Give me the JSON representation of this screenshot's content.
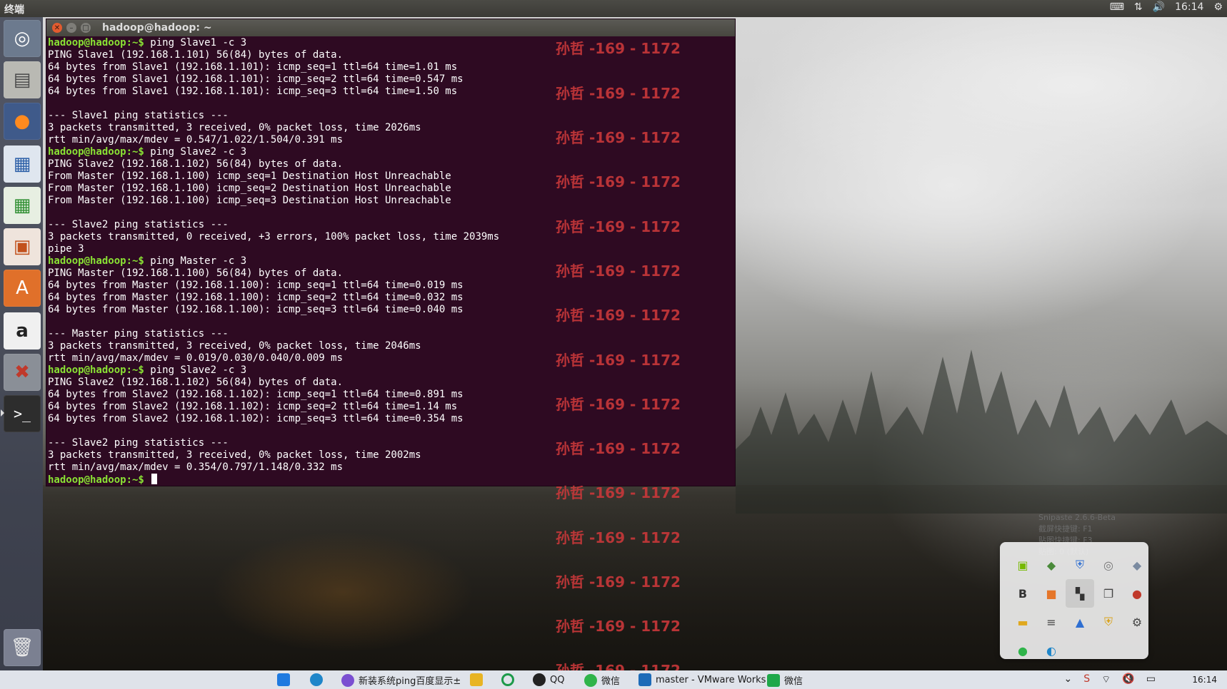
{
  "top_panel": {
    "app_title": "终端",
    "time": "16:14"
  },
  "terminal": {
    "window_title": "hadoop@hadoop: ~",
    "lines": [
      {
        "prompt": "hadoop@hadoop:~$ ",
        "text": "ping Slave1 -c 3"
      },
      {
        "prompt": "",
        "text": "PING Slave1 (192.168.1.101) 56(84) bytes of data."
      },
      {
        "prompt": "",
        "text": "64 bytes from Slave1 (192.168.1.101): icmp_seq=1 ttl=64 time=1.01 ms"
      },
      {
        "prompt": "",
        "text": "64 bytes from Slave1 (192.168.1.101): icmp_seq=2 ttl=64 time=0.547 ms"
      },
      {
        "prompt": "",
        "text": "64 bytes from Slave1 (192.168.1.101): icmp_seq=3 ttl=64 time=1.50 ms"
      },
      {
        "prompt": "",
        "text": ""
      },
      {
        "prompt": "",
        "text": "--- Slave1 ping statistics ---"
      },
      {
        "prompt": "",
        "text": "3 packets transmitted, 3 received, 0% packet loss, time 2026ms"
      },
      {
        "prompt": "",
        "text": "rtt min/avg/max/mdev = 0.547/1.022/1.504/0.391 ms"
      },
      {
        "prompt": "hadoop@hadoop:~$ ",
        "text": "ping Slave2 -c 3"
      },
      {
        "prompt": "",
        "text": "PING Slave2 (192.168.1.102) 56(84) bytes of data."
      },
      {
        "prompt": "",
        "text": "From Master (192.168.1.100) icmp_seq=1 Destination Host Unreachable"
      },
      {
        "prompt": "",
        "text": "From Master (192.168.1.100) icmp_seq=2 Destination Host Unreachable"
      },
      {
        "prompt": "",
        "text": "From Master (192.168.1.100) icmp_seq=3 Destination Host Unreachable"
      },
      {
        "prompt": "",
        "text": ""
      },
      {
        "prompt": "",
        "text": "--- Slave2 ping statistics ---"
      },
      {
        "prompt": "",
        "text": "3 packets transmitted, 0 received, +3 errors, 100% packet loss, time 2039ms"
      },
      {
        "prompt": "",
        "text": "pipe 3"
      },
      {
        "prompt": "hadoop@hadoop:~$ ",
        "text": "ping Master -c 3"
      },
      {
        "prompt": "",
        "text": "PING Master (192.168.1.100) 56(84) bytes of data."
      },
      {
        "prompt": "",
        "text": "64 bytes from Master (192.168.1.100): icmp_seq=1 ttl=64 time=0.019 ms"
      },
      {
        "prompt": "",
        "text": "64 bytes from Master (192.168.1.100): icmp_seq=2 ttl=64 time=0.032 ms"
      },
      {
        "prompt": "",
        "text": "64 bytes from Master (192.168.1.100): icmp_seq=3 ttl=64 time=0.040 ms"
      },
      {
        "prompt": "",
        "text": ""
      },
      {
        "prompt": "",
        "text": "--- Master ping statistics ---"
      },
      {
        "prompt": "",
        "text": "3 packets transmitted, 3 received, 0% packet loss, time 2046ms"
      },
      {
        "prompt": "",
        "text": "rtt min/avg/max/mdev = 0.019/0.030/0.040/0.009 ms"
      },
      {
        "prompt": "hadoop@hadoop:~$ ",
        "text": "ping Slave2 -c 3"
      },
      {
        "prompt": "",
        "text": "PING Slave2 (192.168.1.102) 56(84) bytes of data."
      },
      {
        "prompt": "",
        "text": "64 bytes from Slave2 (192.168.1.102): icmp_seq=1 ttl=64 time=0.891 ms"
      },
      {
        "prompt": "",
        "text": "64 bytes from Slave2 (192.168.1.102): icmp_seq=2 ttl=64 time=1.14 ms"
      },
      {
        "prompt": "",
        "text": "64 bytes from Slave2 (192.168.1.102): icmp_seq=3 ttl=64 time=0.354 ms"
      },
      {
        "prompt": "",
        "text": ""
      },
      {
        "prompt": "",
        "text": "--- Slave2 ping statistics ---"
      },
      {
        "prompt": "",
        "text": "3 packets transmitted, 3 received, 0% packet loss, time 2002ms"
      },
      {
        "prompt": "",
        "text": "rtt min/avg/max/mdev = 0.354/0.797/1.148/0.332 ms"
      },
      {
        "prompt": "hadoop@hadoop:~$ ",
        "text": ""
      }
    ]
  },
  "watermark": {
    "text": "孙哲 -169 - 1172",
    "color": "#c9383a"
  },
  "snipaste_tip": {
    "text": "Snipaste 2.6.6-Beta\n截屏快捷键: F1\n贴图快捷键: F3\n贴图: 0 (默认)"
  },
  "launcher": {
    "items": [
      {
        "name": "dash-home",
        "icon": "ubuntu-logo-icon"
      },
      {
        "name": "files",
        "icon": "file-cabinet-icon"
      },
      {
        "name": "firefox",
        "icon": "firefox-icon"
      },
      {
        "name": "writer",
        "icon": "document-icon"
      },
      {
        "name": "calc",
        "icon": "spreadsheet-icon"
      },
      {
        "name": "impress",
        "icon": "presentation-icon"
      },
      {
        "name": "software-center",
        "icon": "shopping-bag-icon"
      },
      {
        "name": "amazon",
        "icon": "amazon-icon"
      },
      {
        "name": "system-settings",
        "icon": "wrench-icon"
      },
      {
        "name": "terminal",
        "icon": "terminal-icon"
      },
      {
        "name": "trash",
        "icon": "trash-icon"
      }
    ]
  },
  "taskbar": {
    "items": [
      {
        "label": "",
        "icon": "windows-start-icon"
      },
      {
        "label": "",
        "icon": "edge-icon"
      },
      {
        "label": "新装系统ping百度显示±",
        "icon": "browser-icon"
      },
      {
        "label": "",
        "icon": "folder-icon"
      },
      {
        "label": "",
        "icon": "refresh-icon"
      },
      {
        "label": "QQ",
        "icon": "qq-icon"
      },
      {
        "label": "微信",
        "icon": "wechat-icon"
      },
      {
        "label": "master - VMware Works",
        "icon": "vmware-icon"
      },
      {
        "label": "微信",
        "icon": "wechat-icon"
      }
    ],
    "time": "16:14"
  }
}
